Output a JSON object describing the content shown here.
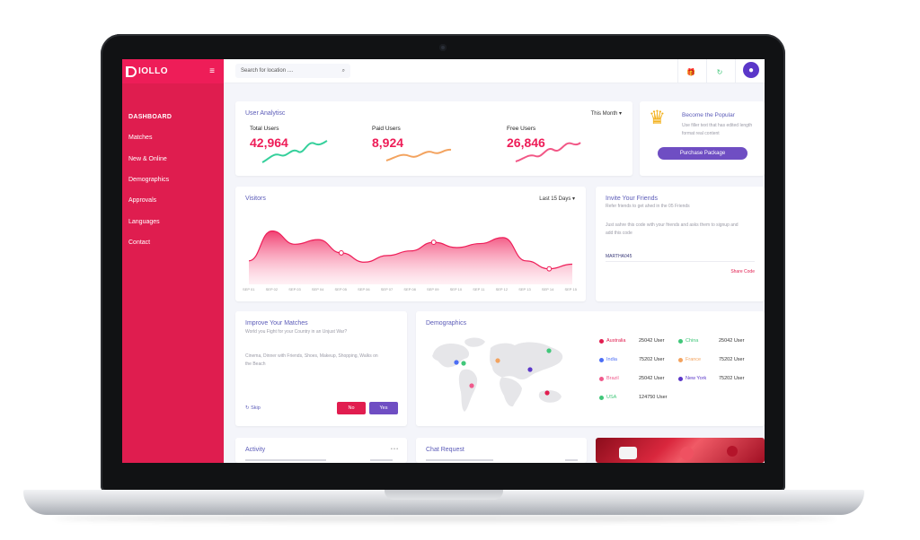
{
  "brand": {
    "name": "IOLLO",
    "hamburger": "≡"
  },
  "nav": [
    {
      "label": "DASHBOARD",
      "active": true
    },
    {
      "label": "Matches",
      "active": false
    },
    {
      "label": "New & Online",
      "active": false
    },
    {
      "label": "Demographics",
      "active": false
    },
    {
      "label": "Approvals",
      "active": false
    },
    {
      "label": "Languages",
      "active": false
    },
    {
      "label": "Contact",
      "active": false
    }
  ],
  "topbar": {
    "search_placeholder": "Search for location ....",
    "search_icon": "⌕",
    "icons": [
      "gift-icon",
      "refresh-icon",
      "user-avatar"
    ],
    "icon_glyphs": [
      "🎁",
      "↻",
      "●"
    ]
  },
  "analytics": {
    "title": "User Analytisc",
    "period": "This Month ▾",
    "stats": [
      {
        "label": "Total Users",
        "value": "42,964",
        "color": "#35d09b"
      },
      {
        "label": "Paid Users",
        "value": "8,924",
        "color": "#f3a35f"
      },
      {
        "label": "Free Users",
        "value": "26,846",
        "color": "#f25786"
      }
    ]
  },
  "promo": {
    "title": "Become the Popular",
    "text": "Use filler text that has edited length format real content",
    "button": "Purchase Package",
    "icon": "crown-icon",
    "icon_glyph": "♛"
  },
  "visitors": {
    "title": "Visitors",
    "period": "Last 15 Days ▾",
    "chart_data": {
      "type": "area",
      "x": [
        "SEP 01",
        "SEP 02",
        "SEP 03",
        "SEP 04",
        "SEP 05",
        "SEP 06",
        "SEP 07",
        "SEP 08",
        "SEP 09",
        "SEP 10",
        "SEP 11",
        "SEP 12",
        "SEP 13",
        "SEP 14",
        "SEP 15"
      ],
      "series": [
        {
          "values": [
            30,
            75,
            55,
            62,
            42,
            28,
            38,
            45,
            58,
            50,
            56,
            65,
            30,
            18,
            25
          ]
        }
      ],
      "color": "#ee1d58"
    }
  },
  "invite": {
    "title": "Invite Your Friends",
    "subtitle": "Refer friends to get ahed in the 05 Friends",
    "text": "Just sahre this code with your friends and asks them to signup and add this code",
    "code": "MARTHA045",
    "share": "Share Code"
  },
  "matches": {
    "title": "Improve Your Matches",
    "question": "World you Fight for your Country in an Unjust War?",
    "interests": "Cinema, Dinner with Friends, Shoes, Makeup, Shopping, Walks on the Beach",
    "skip": "↻ Skip",
    "no": "No",
    "yes": "Yes"
  },
  "demographics": {
    "title": "Demographics",
    "rows": [
      {
        "country": "Australia",
        "value": "25042 User",
        "color": "#e11d4f"
      },
      {
        "country": "India",
        "value": "75202 User",
        "color": "#4c6ef5"
      },
      {
        "country": "Brazil",
        "value": "25042 User",
        "color": "#f05a8c"
      },
      {
        "country": "USA",
        "value": "124750 User",
        "color": "#41c77a"
      },
      {
        "country": "China",
        "value": "25042 User",
        "color": "#41c77a"
      },
      {
        "country": "France",
        "value": "75202 User",
        "color": "#f3a35f"
      },
      {
        "country": "New York",
        "value": "75202 User",
        "color": "#5b37c9"
      }
    ]
  },
  "bottom": {
    "activity": "Activity",
    "more": "• • •",
    "chat": "Chat Request"
  }
}
